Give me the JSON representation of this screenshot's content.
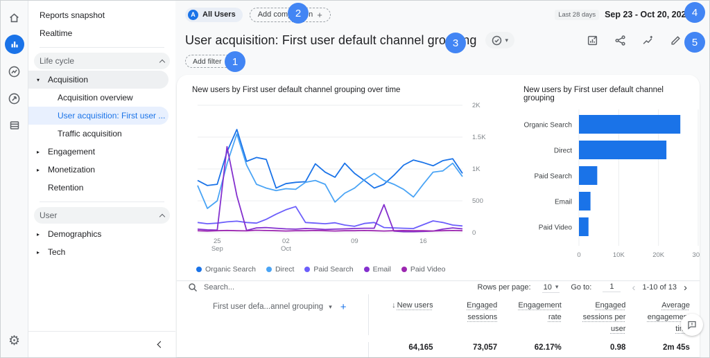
{
  "rail": {
    "icons": [
      "home",
      "reports",
      "explore",
      "advertising",
      "library",
      "settings"
    ]
  },
  "sidebar": {
    "items": [
      {
        "label": "Reports snapshot"
      },
      {
        "label": "Realtime"
      },
      {
        "label": "Life cycle"
      },
      {
        "label": "Acquisition"
      },
      {
        "label": "Acquisition overview"
      },
      {
        "label": "User acquisition: First user ..."
      },
      {
        "label": "Traffic acquisition"
      },
      {
        "label": "Engagement"
      },
      {
        "label": "Monetization"
      },
      {
        "label": "Retention"
      },
      {
        "label": "User"
      },
      {
        "label": "Demographics"
      },
      {
        "label": "Tech"
      }
    ]
  },
  "header": {
    "audience_badge": "A",
    "audience_chip": "All Users",
    "add_comparison": "Add comparison",
    "date_preset": "Last 28 days",
    "date_range": "Sep 23 - Oct 20, 2022",
    "title": "User acquisition: First user default channel grouping",
    "add_filter": "Add filter",
    "action_icons": [
      "chart-edit",
      "share",
      "insights",
      "edit"
    ]
  },
  "annotations": [
    "1",
    "2",
    "3",
    "4",
    "5"
  ],
  "chart_data": [
    {
      "type": "line",
      "title": "New users by First user default channel grouping over time",
      "ylim": [
        0,
        2000
      ],
      "yticks": [
        {
          "v": 0,
          "label": "0"
        },
        {
          "v": 500,
          "label": "500"
        },
        {
          "v": 1000,
          "label": "1K"
        },
        {
          "v": 1500,
          "label": "1.5K"
        },
        {
          "v": 2000,
          "label": "2K"
        }
      ],
      "x_labels": [
        {
          "i": 2,
          "label": "25",
          "sub": "Sep"
        },
        {
          "i": 9,
          "label": "02",
          "sub": "Oct"
        },
        {
          "i": 16,
          "label": "09"
        },
        {
          "i": 23,
          "label": "16"
        }
      ],
      "x_range": "Sep 23 - Oct 20, 2022",
      "grid": true,
      "legend_position": "bottom",
      "series": [
        {
          "name": "Organic Search",
          "color": "#1a73e8",
          "values": [
            820,
            740,
            760,
            1270,
            1620,
            1120,
            1180,
            1150,
            700,
            770,
            790,
            800,
            1080,
            950,
            870,
            1090,
            930,
            820,
            700,
            760,
            900,
            1060,
            1140,
            1100,
            1050,
            1130,
            1160,
            930
          ]
        },
        {
          "name": "Direct",
          "color": "#4aa4f5",
          "values": [
            740,
            380,
            500,
            1080,
            1550,
            1060,
            760,
            700,
            660,
            690,
            680,
            790,
            820,
            760,
            480,
            620,
            700,
            830,
            930,
            820,
            760,
            680,
            560,
            760,
            950,
            970,
            1090,
            880
          ]
        },
        {
          "name": "Paid Search",
          "color": "#6c5efb",
          "values": [
            160,
            140,
            150,
            170,
            180,
            160,
            150,
            210,
            290,
            360,
            410,
            160,
            150,
            140,
            155,
            120,
            100,
            145,
            160,
            80,
            75,
            70,
            65,
            125,
            185,
            160,
            120,
            105
          ]
        },
        {
          "name": "Email",
          "color": "#8430ce",
          "values": [
            55,
            45,
            40,
            1350,
            580,
            35,
            75,
            80,
            70,
            60,
            55,
            65,
            60,
            50,
            55,
            60,
            65,
            70,
            70,
            440,
            25,
            15,
            15,
            20,
            25,
            55,
            75,
            60
          ]
        },
        {
          "name": "Paid Video",
          "color": "#9c27b0",
          "values": [
            30,
            25,
            30,
            35,
            30,
            28,
            38,
            34,
            30,
            26,
            30,
            30,
            34,
            30,
            26,
            30,
            30,
            34,
            30,
            26,
            30,
            34,
            30,
            30,
            26,
            30,
            34,
            30
          ]
        }
      ]
    },
    {
      "type": "bar",
      "orientation": "horizontal",
      "title": "New users by First user default channel grouping",
      "categories": [
        "Organic Search",
        "Direct",
        "Paid Search",
        "Email",
        "Paid Video"
      ],
      "values": [
        25500,
        22000,
        4600,
        2900,
        2400
      ],
      "color": "#1a73e8",
      "xlim": [
        0,
        30000
      ],
      "xticks": [
        {
          "v": 0,
          "label": "0"
        },
        {
          "v": 10000,
          "label": "10K"
        },
        {
          "v": 20000,
          "label": "20K"
        },
        {
          "v": 30000,
          "label": "30K"
        }
      ],
      "grid": true
    }
  ],
  "table": {
    "search_placeholder": "Search...",
    "rows_per_page_label": "Rows per page:",
    "rows_per_page_value": "10",
    "goto_label": "Go to:",
    "goto_value": "1",
    "pagination": "1-10 of 13",
    "dimension_header": "First user defa...annel grouping",
    "columns": [
      "New users",
      "Engaged sessions",
      "Engagement rate",
      "Engaged sessions per user",
      "Average engagement time"
    ],
    "totals": [
      "64,165",
      "73,057",
      "62.17%",
      "0.98",
      "2m 45s"
    ]
  }
}
